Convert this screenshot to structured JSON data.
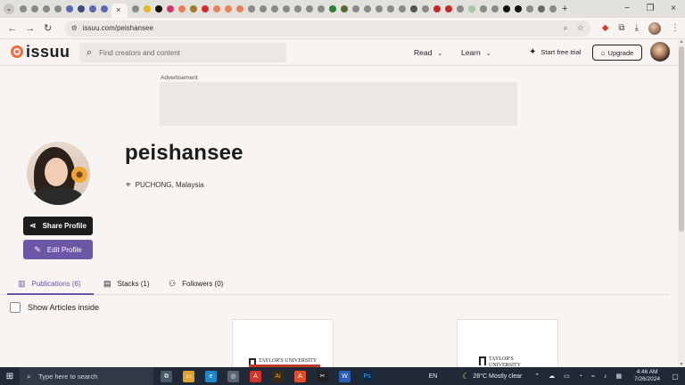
{
  "browser": {
    "tab_menu_icon": "chevron-down-icon",
    "active_tab_close": "×",
    "new_tab": "+",
    "window_controls": [
      "−",
      "❐",
      "×"
    ],
    "url": "issuu.com/peishansee",
    "nav": {
      "back": "←",
      "forward": "→",
      "reload": "↻"
    },
    "omnibox_icons": [
      "search-icon",
      "star-icon"
    ]
  },
  "header": {
    "logo_text": "issuu",
    "search_placeholder": "Find creators and content",
    "read_label": "Read",
    "learn_label": "Learn",
    "trial_label": "Start free trial",
    "upgrade_label": "Upgrade"
  },
  "ad": {
    "label": "Advertisement"
  },
  "profile": {
    "username": "peishansee",
    "location": "PUCHONG, Malaysia",
    "share_label": "Share Profile",
    "edit_label": "Edit Profile"
  },
  "tabs": {
    "publications": "Publications (6)",
    "stacks": "Stacks (1)",
    "followers": "Followers (0)"
  },
  "options": {
    "show_articles": "Show Articles inside"
  },
  "cards": [
    {
      "logo_text_1": "TAYLOR'S UNIVERSITY"
    },
    {
      "logo_text_1": "TAYLOR'S",
      "logo_text_2": "UNIVERSITY"
    }
  ],
  "taskbar": {
    "search_placeholder": "Type here to search",
    "language": "EN",
    "weather": "28°C  Mostly clear",
    "time": "4:46 AM",
    "date": "7/26/2024"
  },
  "colors": {
    "brand_orange": "#f36c45",
    "accent_purple": "#6c57a6",
    "page_bg": "#f7f4f1"
  }
}
